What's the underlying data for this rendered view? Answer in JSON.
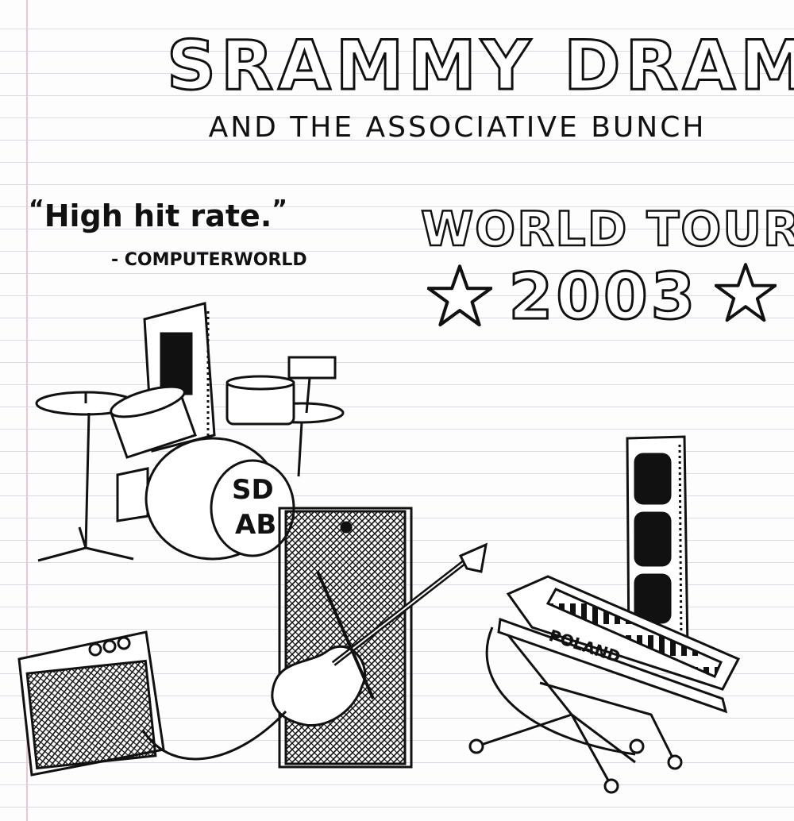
{
  "band": {
    "name": "SRAMMY DRAM",
    "subtitle": "AND THE ASSOCIATIVE BUNCH"
  },
  "review": {
    "quote": "High hit rate.",
    "open_mark": "“",
    "close_mark": "”",
    "source": "- COMPUTERWORLD"
  },
  "tour": {
    "label": "WORLD TOUR",
    "year": "2003"
  },
  "instruments": {
    "bass_drum_text": "SD AB",
    "keyboard_brand": "POLAND"
  },
  "icons": [
    "star-icon",
    "drum-kit",
    "guitar-amp",
    "bass-guitar",
    "speaker-cabinet",
    "keyboard",
    "memory-module"
  ]
}
